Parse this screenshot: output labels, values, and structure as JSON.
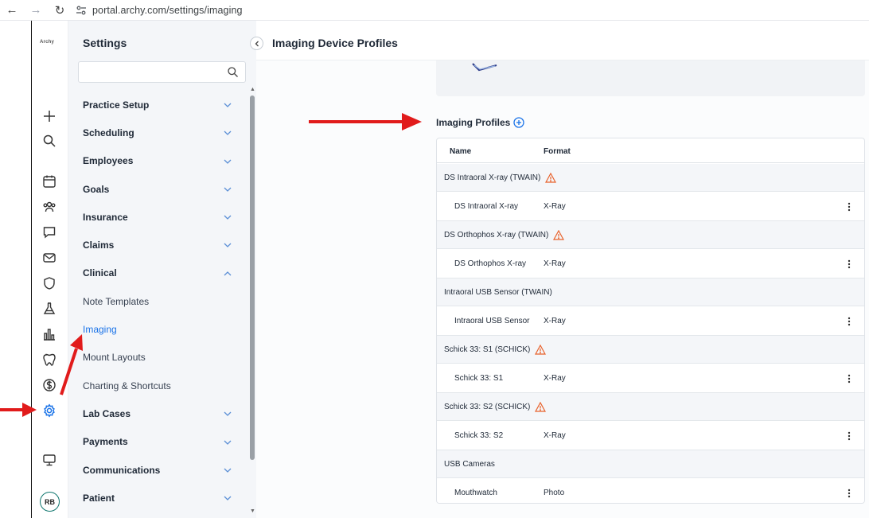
{
  "browser": {
    "url": "portal.archy.com/settings/imaging"
  },
  "rail": {
    "logo_text": "Archy",
    "avatar_initials": "RB"
  },
  "settings": {
    "title": "Settings",
    "search_placeholder": "",
    "menu": [
      {
        "label": "Practice Setup",
        "type": "section",
        "expanded": false
      },
      {
        "label": "Scheduling",
        "type": "section",
        "expanded": false
      },
      {
        "label": "Employees",
        "type": "section",
        "expanded": false
      },
      {
        "label": "Goals",
        "type": "section",
        "expanded": false
      },
      {
        "label": "Insurance",
        "type": "section",
        "expanded": false
      },
      {
        "label": "Claims",
        "type": "section",
        "expanded": false
      },
      {
        "label": "Clinical",
        "type": "section",
        "expanded": true
      },
      {
        "label": "Note Templates",
        "type": "sub"
      },
      {
        "label": "Imaging",
        "type": "sub",
        "active": true
      },
      {
        "label": "Mount Layouts",
        "type": "sub"
      },
      {
        "label": "Charting & Shortcuts",
        "type": "sub"
      },
      {
        "label": "Lab Cases",
        "type": "section",
        "expanded": false
      },
      {
        "label": "Payments",
        "type": "section",
        "expanded": false
      },
      {
        "label": "Communications",
        "type": "section",
        "expanded": false
      },
      {
        "label": "Patient",
        "type": "section",
        "expanded": false
      }
    ]
  },
  "main": {
    "title": "Imaging Device Profiles",
    "profiles_label": "Imaging Profiles",
    "columns": {
      "name": "Name",
      "format": "Format"
    },
    "groups": [
      {
        "label": "DS Intraoral X-ray (TWAIN)",
        "warning": true,
        "items": [
          {
            "name": "DS Intraoral X-ray",
            "format": "X-Ray"
          }
        ]
      },
      {
        "label": "DS Orthophos X-ray (TWAIN)",
        "warning": true,
        "items": [
          {
            "name": "DS Orthophos X-ray",
            "format": "X-Ray"
          }
        ]
      },
      {
        "label": "Intraoral USB Sensor (TWAIN)",
        "warning": false,
        "items": [
          {
            "name": "Intraoral USB Sensor",
            "format": "X-Ray"
          }
        ]
      },
      {
        "label": "Schick 33: S1 (SCHICK)",
        "warning": true,
        "items": [
          {
            "name": "Schick 33: S1",
            "format": "X-Ray"
          }
        ]
      },
      {
        "label": "Schick 33: S2 (SCHICK)",
        "warning": true,
        "items": [
          {
            "name": "Schick 33: S2",
            "format": "X-Ray"
          }
        ]
      },
      {
        "label": "USB Cameras",
        "warning": false,
        "items": [
          {
            "name": "Mouthwatch",
            "format": "Photo"
          }
        ]
      }
    ]
  },
  "colors": {
    "accent": "#1a73e8",
    "warning": "#e8622c",
    "annotation": "#e11b1b"
  }
}
